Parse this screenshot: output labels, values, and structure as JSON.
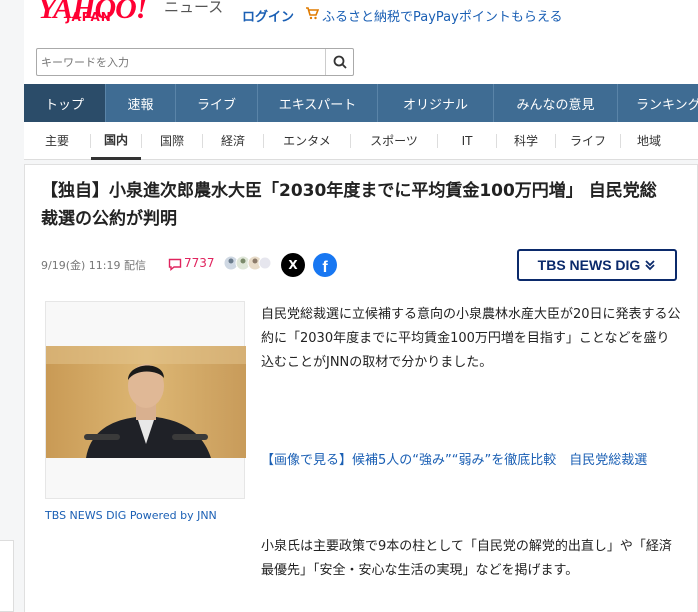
{
  "header": {
    "logo": "YAHOO!",
    "logo_sub": "JAPAN",
    "logo_news": "ニュース",
    "login": "ログイン",
    "furusato": "ふるさと納税でPayPayポイントもらえる",
    "search_placeholder": "キーワードを入力"
  },
  "nav": {
    "items": [
      {
        "label": "トップ",
        "active": true
      },
      {
        "label": "速報"
      },
      {
        "label": "ライブ"
      },
      {
        "label": "エキスパート"
      },
      {
        "label": "オリジナル"
      },
      {
        "label": "みんなの意見"
      },
      {
        "label": "ランキング"
      }
    ]
  },
  "subnav": {
    "items": [
      {
        "label": "主要"
      },
      {
        "label": "国内",
        "active": true
      },
      {
        "label": "国際"
      },
      {
        "label": "経済"
      },
      {
        "label": "エンタメ"
      },
      {
        "label": "スポーツ"
      },
      {
        "label": "IT"
      },
      {
        "label": "科学"
      },
      {
        "label": "ライフ"
      },
      {
        "label": "地域"
      }
    ]
  },
  "article": {
    "title": "【独自】小泉進次郎農水大臣「2030年度までに平均賃金100万円増」 自民党総裁選の公約が判明",
    "date": "9/19(金) 11:19 配信",
    "comment_count": "7737",
    "share_x": "X",
    "share_fb": "f",
    "provider": "TBS NEWS DIG",
    "caption": "TBS NEWS DIG Powered by JNN",
    "body1": "自民党総裁選に立候補する意向の小泉農林水産大臣が20日に発表する公約に「2030年度までに平均賃金100万円増を目指す」ことなどを盛り込むことがJNNの取材で分かりました。",
    "link": "【画像で見る】候補5人の“強み”“弱み”を徹底比較　自民党総裁選",
    "body2": "小泉氏は主要政策で9本の柱として「自民党の解党的出直し」や「経済最優先」「安全・安心な生活の実現」などを掲げます。"
  },
  "colors": {
    "yahoo_red": "#ff0033",
    "nav_blue": "#3f6c93",
    "link_blue": "#1a5fb4",
    "comment_pink": "#e0245e"
  }
}
